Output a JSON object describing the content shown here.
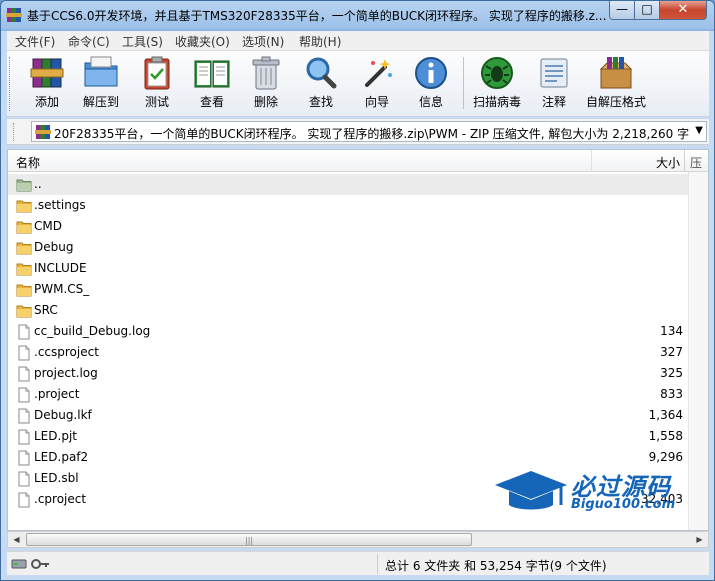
{
  "window": {
    "title": "基于CCS6.0开发环境，并且基于TMS320F28335平台，一个简单的BUCK闭环程序。 实现了程序的搬移.z...",
    "minimize_glyph": "—",
    "maximize_glyph": "□",
    "close_glyph": "✕"
  },
  "menu": {
    "items": [
      {
        "label": "文件(F)"
      },
      {
        "label": "命令(C)"
      },
      {
        "label": "工具(S)"
      },
      {
        "label": "收藏夹(O)"
      },
      {
        "label": "选项(N)"
      },
      {
        "label": "帮助(H)"
      }
    ]
  },
  "toolbar": {
    "items": [
      {
        "label": "添加",
        "icon": "books-add-icon"
      },
      {
        "label": "解压到",
        "icon": "folder-extract-icon"
      },
      {
        "label": "测试",
        "icon": "clipboard-check-icon"
      },
      {
        "label": "查看",
        "icon": "open-book-icon"
      },
      {
        "label": "删除",
        "icon": "trash-icon"
      },
      {
        "label": "查找",
        "icon": "magnifier-icon"
      },
      {
        "label": "向导",
        "icon": "wand-icon"
      },
      {
        "label": "信息",
        "icon": "info-icon"
      },
      {
        "label": "扫描病毒",
        "icon": "bug-scan-icon"
      },
      {
        "label": "注释",
        "icon": "comment-icon"
      },
      {
        "label": "自解压格式",
        "icon": "sfx-box-icon"
      }
    ]
  },
  "address": {
    "path": "20F28335平台，一个简单的BUCK闭环程序。 实现了程序的搬移.zip\\PWM - ZIP 压缩文件, 解包大小为 2,218,260 字节",
    "dropdown_glyph": "▼"
  },
  "columns": {
    "name": "名称",
    "size": "大小",
    "extra": "压"
  },
  "files": [
    {
      "name": "..",
      "size": "",
      "type": "parent"
    },
    {
      "name": ".settings",
      "size": "",
      "type": "folder"
    },
    {
      "name": "CMD",
      "size": "",
      "type": "folder"
    },
    {
      "name": "Debug",
      "size": "",
      "type": "folder"
    },
    {
      "name": "INCLUDE",
      "size": "",
      "type": "folder"
    },
    {
      "name": "PWM.CS_",
      "size": "",
      "type": "folder"
    },
    {
      "name": "SRC",
      "size": "",
      "type": "folder"
    },
    {
      "name": "cc_build_Debug.log",
      "size": "134",
      "type": "file"
    },
    {
      "name": ".ccsproject",
      "size": "327",
      "type": "file"
    },
    {
      "name": "project.log",
      "size": "325",
      "type": "file"
    },
    {
      "name": ".project",
      "size": "833",
      "type": "file"
    },
    {
      "name": "Debug.lkf",
      "size": "1,364",
      "type": "file"
    },
    {
      "name": "LED.pjt",
      "size": "1,558",
      "type": "file"
    },
    {
      "name": "LED.paf2",
      "size": "9,296",
      "type": "file"
    },
    {
      "name": "LED.sbl",
      "size": "",
      "type": "file"
    },
    {
      "name": ".cproject",
      "size": "32,403",
      "type": "file"
    }
  ],
  "status": {
    "text": "总计 6 文件夹 和 53,254 字节(9 个文件)"
  },
  "watermark": {
    "title": "必过源码",
    "url": "Biguo100.com"
  },
  "colors": {
    "folder": "#f2c54a",
    "accent": "#1565b8",
    "close": "#c6452c"
  }
}
